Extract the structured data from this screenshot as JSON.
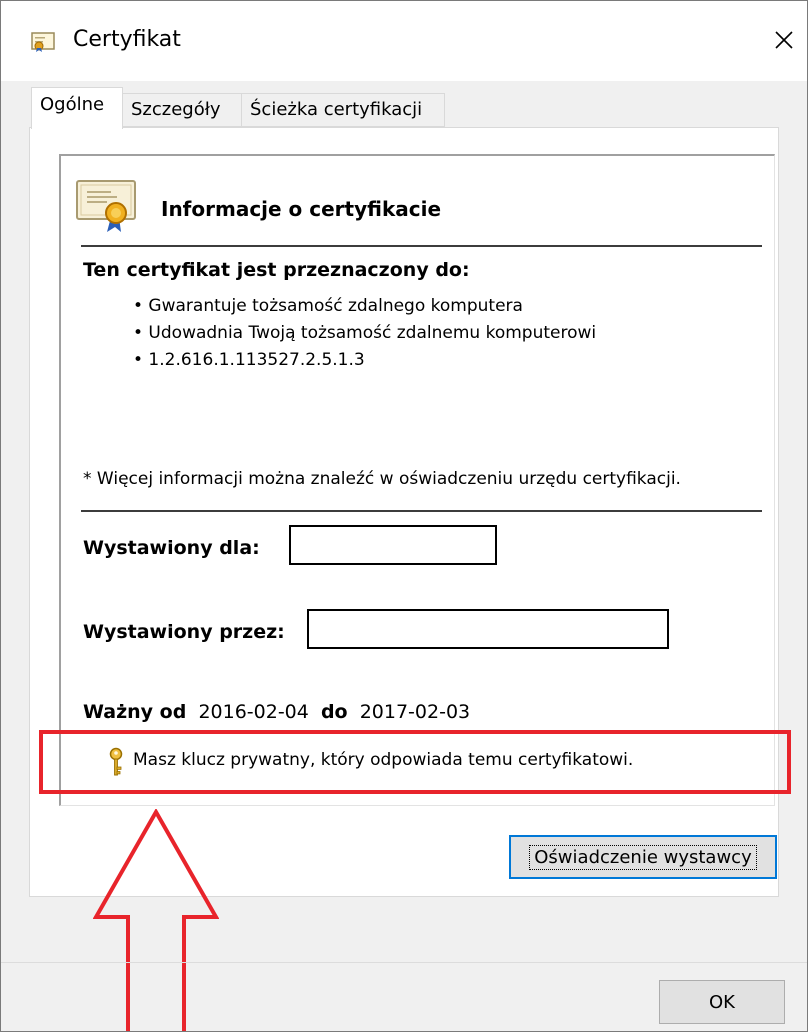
{
  "window": {
    "title": "Certyfikat",
    "close_glyph": "✕"
  },
  "tabs": [
    {
      "label": "Ogólne",
      "active": true
    },
    {
      "label": "Szczegóły",
      "active": false
    },
    {
      "label": "Ścieżka certyfikacji",
      "active": false
    }
  ],
  "info": {
    "title": "Informacje o certyfikacie",
    "purpose_heading": "Ten certyfikat jest przeznaczony do:",
    "purposes": [
      "• Gwarantuje tożsamość zdalnego komputera",
      "• Udowadnia Twoją tożsamość zdalnemu komputerowi",
      "• 1.2.616.1.113527.2.5.1.3"
    ],
    "note": "* Więcej informacji można znaleźć w oświadczeniu urzędu certyfikacji.",
    "issued_to_label": "Wystawiony dla:",
    "issued_to_value": "",
    "issued_by_label": "Wystawiony przez:",
    "issued_by_value": "",
    "valid_from_label": "Ważny od",
    "valid_from": "2016-02-04",
    "valid_to_label": "do",
    "valid_to": "2017-02-03",
    "private_key_text": "Masz klucz prywatny, który odpowiada temu certyfikatowi."
  },
  "buttons": {
    "issuer_statement": "Oświadczenie wystawcy",
    "ok": "OK"
  },
  "colors": {
    "highlight": "#e8242b",
    "focus": "#0078d7"
  },
  "icons": {
    "title": "certificate-icon",
    "info": "certificate-icon",
    "key": "key-icon",
    "annotation": "arrow-up-icon"
  }
}
